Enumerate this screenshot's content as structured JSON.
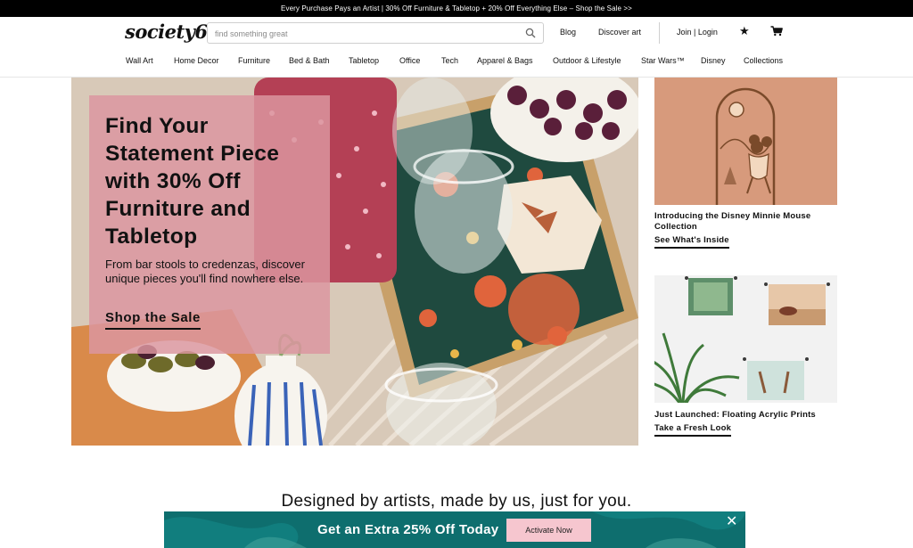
{
  "promo": {
    "text": "Every Purchase Pays an Artist | 30% Off Furniture & Tabletop + 20% Off Everything Else – Shop the Sale >>"
  },
  "header": {
    "logo": "society6",
    "search": {
      "placeholder": "find something great",
      "value": ""
    },
    "links": {
      "blog": "Blog",
      "discover": "Discover art",
      "join": "Join | Login"
    },
    "icons": {
      "search": "search-icon",
      "favorites": "star-icon",
      "cart": "cart-icon"
    }
  },
  "nav": [
    "Wall Art",
    "Home Decor",
    "Furniture",
    "Bed & Bath",
    "Tabletop",
    "Office",
    "Tech",
    "Apparel & Bags",
    "Outdoor & Lifestyle",
    "Star Wars™",
    "Disney",
    "Collections"
  ],
  "hero": {
    "title": "Find Your Statement Piece with 30% Off Furniture and Tabletop",
    "subtitle": "From bar stools to credenzas, discover unique pieces you'll find nowhere else.",
    "cta": "Shop the Sale",
    "panel_color": "#db96a0"
  },
  "cards": [
    {
      "title": "Introducing the Disney Minnie Mouse Collection",
      "link": "See What's Inside",
      "bg_color": "#d79a7c"
    },
    {
      "title": "Just Launched: Floating Acrylic Prints",
      "link": "Take a Fresh Look",
      "bg_color": "#f2f2f2"
    }
  ],
  "tagline": "Designed by artists, made by us, just for you.",
  "banner": {
    "text": "Get an Extra 25% Off Today",
    "button": "Activate Now",
    "bg_color": "#0e6e6e",
    "button_color": "#f6c6cf"
  }
}
